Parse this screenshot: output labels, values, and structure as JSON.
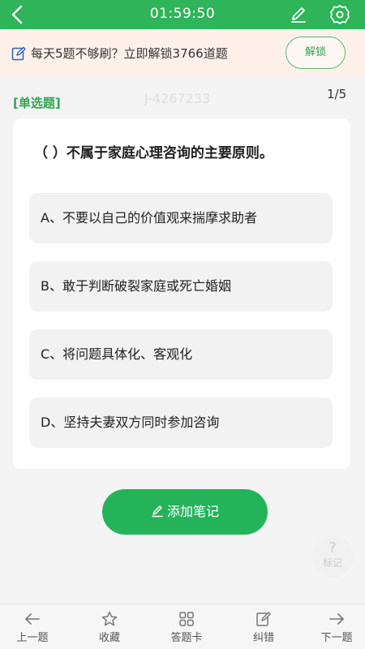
{
  "status_bar": {
    "time": "01:59:50"
  },
  "promo": {
    "text": "每天5题不够刷？立即解锁3766道题",
    "unlock_label": "解锁"
  },
  "question": {
    "type": "[单选题]",
    "id": "J-4267233",
    "progress": "1/5",
    "title": "（  ）不属于家庭心理咨询的主要原则。",
    "options": [
      "A、不要以自己的价值观来揣摩求助者",
      "B、敢于判断破裂家庭或死亡婚姻",
      "C、将问题具体化、客观化",
      "D、坚持夫妻双方同时参加咨询"
    ]
  },
  "add_note_label": "添加笔记",
  "mark": {
    "icon": "?",
    "label": "标记"
  },
  "bottom_nav": [
    {
      "label": "上一题",
      "icon": "arrow-left-icon"
    },
    {
      "label": "收藏",
      "icon": "star-icon"
    },
    {
      "label": "答题卡",
      "icon": "grid-icon"
    },
    {
      "label": "纠错",
      "icon": "edit-icon"
    },
    {
      "label": "下一题",
      "icon": "arrow-right-icon"
    }
  ],
  "colors": {
    "primary": "#2fb45a",
    "promo_bg": "#fff1ea",
    "page_bg": "#f4f4f4"
  }
}
